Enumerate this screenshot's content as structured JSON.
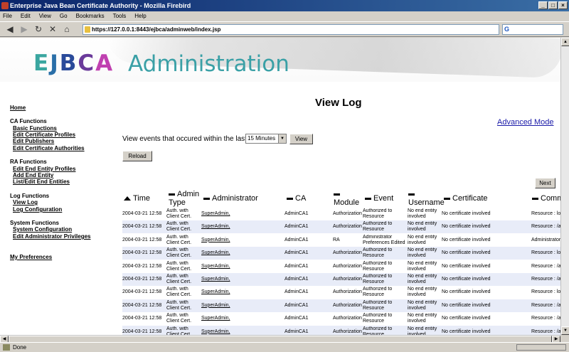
{
  "window": {
    "title": "Enterprise Java Bean Certificate Authority - Mozilla Firebird",
    "buttons": [
      "_",
      "□",
      "×"
    ]
  },
  "menu": [
    "File",
    "Edit",
    "View",
    "Go",
    "Bookmarks",
    "Tools",
    "Help"
  ],
  "nav": {
    "url": "https://127.0.0.1:8443/ejbca/adminweb/index.jsp",
    "search_value": "G"
  },
  "banner": {
    "logo": [
      "E",
      "J",
      "B",
      "C",
      "A"
    ],
    "title": "Administration"
  },
  "sidebar": {
    "home": "Home",
    "groups": [
      {
        "title": "CA Functions",
        "items": [
          "Basic Functions",
          "Edit Certificate Profiles",
          "Edit Publishers",
          "Edit Certificate Authorities"
        ]
      },
      {
        "title": "RA Functions",
        "items": [
          "Edit End Entity Profiles",
          "Add End Entity",
          "List/Edit End Entities"
        ]
      },
      {
        "title": "Log Functions",
        "items": [
          "View Log",
          "Log Configuration"
        ]
      },
      {
        "title": "System Functions",
        "items": [
          "System Configuration",
          "Edit Administrator Privileges"
        ]
      }
    ],
    "preferences": "My Preferences"
  },
  "main": {
    "page_title": "View Log",
    "advanced_mode": "Advanced Mode",
    "filter_label": "View events that occured within the last",
    "filter_value": "15 Minutes",
    "view_button": "View",
    "reload_button": "Reload",
    "next_button": "Next"
  },
  "table": {
    "headers": [
      "Time",
      "Admin Type",
      "Administrator",
      "CA",
      "Module",
      "Event",
      "Username",
      "Certificate",
      "Comment"
    ],
    "rows": [
      [
        "2004-03-21 12:58",
        "Auth. with Client Cert.",
        "SuperAdmin,",
        "AdminCA1",
        "Authorization",
        "Authorized to Resource",
        "No end entity involved",
        "No certificate involved",
        "Resource : lo"
      ],
      [
        "2004-03-21 12:58",
        "Auth. with Client Cert.",
        "SuperAdmin,",
        "AdminCA1",
        "Authorization",
        "Authorized to Resource",
        "No end entity involved",
        "No certificate involved",
        "Resource : /a"
      ],
      [
        "2004-03-21 12:58",
        "Auth. with Client Cert.",
        "SuperAdmin,",
        "AdminCA1",
        "RA",
        "Administrator Preferences Edited",
        "No end entity involved",
        "No certificate involved",
        "Administrator"
      ],
      [
        "2004-03-21 12:58",
        "Auth. with Client Cert.",
        "SuperAdmin,",
        "AdminCA1",
        "Authorization",
        "Authorized to Resource",
        "No end entity involved",
        "No certificate involved",
        "Resource : lo"
      ],
      [
        "2004-03-21 12:58",
        "Auth. with Client Cert.",
        "SuperAdmin,",
        "AdminCA1",
        "Authorization",
        "Authorized to Resource",
        "No end entity involved",
        "No certificate involved",
        "Resource : /a"
      ],
      [
        "2004-03-21 12:58",
        "Auth. with Client Cert.",
        "SuperAdmin,",
        "AdminCA1",
        "Authorization",
        "Authorized to Resource",
        "No end entity involved",
        "No certificate involved",
        "Resource : /a"
      ],
      [
        "2004-03-21 12:58",
        "Auth. with Client Cert.",
        "SuperAdmin,",
        "AdminCA1",
        "Authorization",
        "Authorized to Resource",
        "No end entity involved",
        "No certificate involved",
        "Resource : lo"
      ],
      [
        "2004-03-21 12:58",
        "Auth. with Client Cert.",
        "SuperAdmin,",
        "AdminCA1",
        "Authorization",
        "Authorized to Resource",
        "No end entity involved",
        "No certificate involved",
        "Resource : /a"
      ],
      [
        "2004-03-21 12:58",
        "Auth. with Client Cert.",
        "SuperAdmin,",
        "AdminCA1",
        "Authorization",
        "Authorized to Resource",
        "No end entity involved",
        "No certificate involved",
        "Resource : /a"
      ],
      [
        "2004-03-21 12:58",
        "Auth. with Client Cert.",
        "SuperAdmin,",
        "AdminCA1",
        "Authorization",
        "Authorized to Resource",
        "No end entity involved",
        "No certificate involved",
        "Resource : /a"
      ]
    ]
  },
  "status": {
    "text": "Done"
  },
  "colors": {
    "alt_row": "#e8ecf8",
    "link": "#1a1aa8",
    "title_bar": "#0a246a"
  }
}
